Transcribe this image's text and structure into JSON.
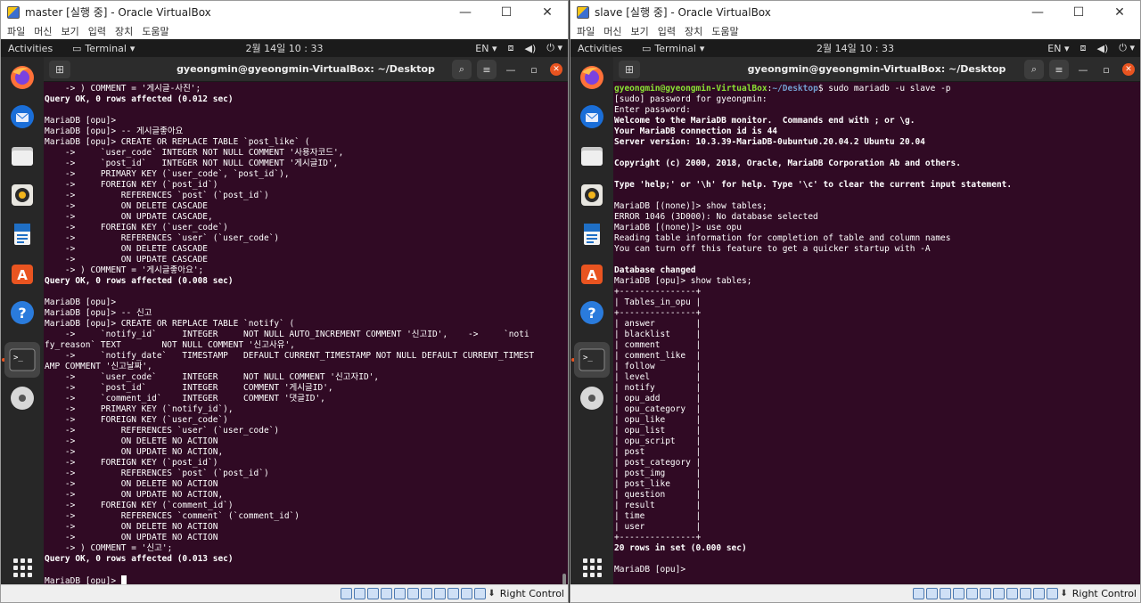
{
  "left": {
    "title": "master [실행 중] - Oracle VirtualBox",
    "menu": [
      "파일",
      "머신",
      "보기",
      "입력",
      "장치",
      "도움말"
    ],
    "topbar": {
      "activities": "Activities",
      "app": "Terminal",
      "clock": "2월 14일  10 : 33",
      "lang": "EN"
    },
    "term_title": "gyeongmin@gyeongmin-VirtualBox: ~/Desktop",
    "host_key": "Right Control",
    "lines": [
      "    -> ) COMMENT = '게시글-사진';",
      "Query OK, 0 rows affected (0.012 sec)",
      "",
      "MariaDB [opu]>",
      "MariaDB [opu]> -- 게시글좋아요",
      "MariaDB [opu]> CREATE OR REPLACE TABLE `post_like` (",
      "    ->     `user_code` INTEGER NOT NULL COMMENT '사용자코드',",
      "    ->     `post_id`   INTEGER NOT NULL COMMENT '게시글ID',",
      "    ->     PRIMARY KEY (`user_code`, `post_id`),",
      "    ->     FOREIGN KEY (`post_id`)",
      "    ->         REFERENCES `post` (`post_id`)",
      "    ->         ON DELETE CASCADE",
      "    ->         ON UPDATE CASCADE,",
      "    ->     FOREIGN KEY (`user_code`)",
      "    ->         REFERENCES `user` (`user_code`)",
      "    ->         ON DELETE CASCADE",
      "    ->         ON UPDATE CASCADE",
      "    -> ) COMMENT = '게시글좋아요';",
      "Query OK, 0 rows affected (0.008 sec)",
      "",
      "MariaDB [opu]>",
      "MariaDB [opu]> -- 신고",
      "MariaDB [opu]> CREATE OR REPLACE TABLE `notify` (",
      "    ->     `notify_id`     INTEGER     NOT NULL AUTO_INCREMENT COMMENT '신고ID',    ->     `noti",
      "fy_reason` TEXT        NOT NULL COMMENT '신고사유',",
      "    ->     `notify_date`   TIMESTAMP   DEFAULT CURRENT_TIMESTAMP NOT NULL DEFAULT CURRENT_TIMEST",
      "AMP COMMENT '신고날짜',",
      "    ->     `user_code`     INTEGER     NOT NULL COMMENT '신고자ID',",
      "    ->     `post_id`       INTEGER     COMMENT '게시글ID',",
      "    ->     `comment_id`    INTEGER     COMMENT '댓글ID',",
      "    ->     PRIMARY KEY (`notify_id`),",
      "    ->     FOREIGN KEY (`user_code`)",
      "    ->         REFERENCES `user` (`user_code`)",
      "    ->         ON DELETE NO ACTION",
      "    ->         ON UPDATE NO ACTION,",
      "    ->     FOREIGN KEY (`post_id`)",
      "    ->         REFERENCES `post` (`post_id`)",
      "    ->         ON DELETE NO ACTION",
      "    ->         ON UPDATE NO ACTION,",
      "    ->     FOREIGN KEY (`comment_id`)",
      "    ->         REFERENCES `comment` (`comment_id`)",
      "    ->         ON DELETE NO ACTION",
      "    ->         ON UPDATE NO ACTION",
      "    -> ) COMMENT = '신고';",
      "Query OK, 0 rows affected (0.013 sec)",
      "",
      "MariaDB [opu]> "
    ]
  },
  "right": {
    "title": "slave [실행 중] - Oracle VirtualBox",
    "menu": [
      "파일",
      "머신",
      "보기",
      "입력",
      "장치",
      "도움말"
    ],
    "topbar": {
      "activities": "Activities",
      "app": "Terminal",
      "clock": "2월 14일  10 : 33",
      "lang": "EN"
    },
    "term_title": "gyeongmin@gyeongmin-VirtualBox: ~/Desktop",
    "host_key": "Right Control",
    "prompt_user": "gyeongmin@gyeongmin-VirtualBox",
    "prompt_path": "~/Desktop",
    "prompt_cmd": "$ sudo mariadb -u slave -p",
    "lines": [
      "[sudo] password for gyeongmin:",
      "Enter password:",
      "Welcome to the MariaDB monitor.  Commands end with ; or \\g.",
      "Your MariaDB connection id is 44",
      "Server version: 10.3.39-MariaDB-0ubuntu0.20.04.2 Ubuntu 20.04",
      "",
      "Copyright (c) 2000, 2018, Oracle, MariaDB Corporation Ab and others.",
      "",
      "Type 'help;' or '\\h' for help. Type '\\c' to clear the current input statement.",
      "",
      "MariaDB [(none)]> show tables;",
      "ERROR 1046 (3D000): No database selected",
      "MariaDB [(none)]> use opu",
      "Reading table information for completion of table and column names",
      "You can turn off this feature to get a quicker startup with -A",
      "",
      "Database changed",
      "MariaDB [opu]> show tables;",
      "+---------------+",
      "| Tables_in_opu |",
      "+---------------+",
      "| answer        |",
      "| blacklist     |",
      "| comment       |",
      "| comment_like  |",
      "| follow        |",
      "| level         |",
      "| notify        |",
      "| opu_add       |",
      "| opu_category  |",
      "| opu_like      |",
      "| opu_list      |",
      "| opu_script    |",
      "| post          |",
      "| post_category |",
      "| post_img      |",
      "| post_like     |",
      "| question      |",
      "| result        |",
      "| time          |",
      "| user          |",
      "+---------------+",
      "20 rows in set (0.000 sec)",
      "",
      "MariaDB [opu]> "
    ]
  }
}
